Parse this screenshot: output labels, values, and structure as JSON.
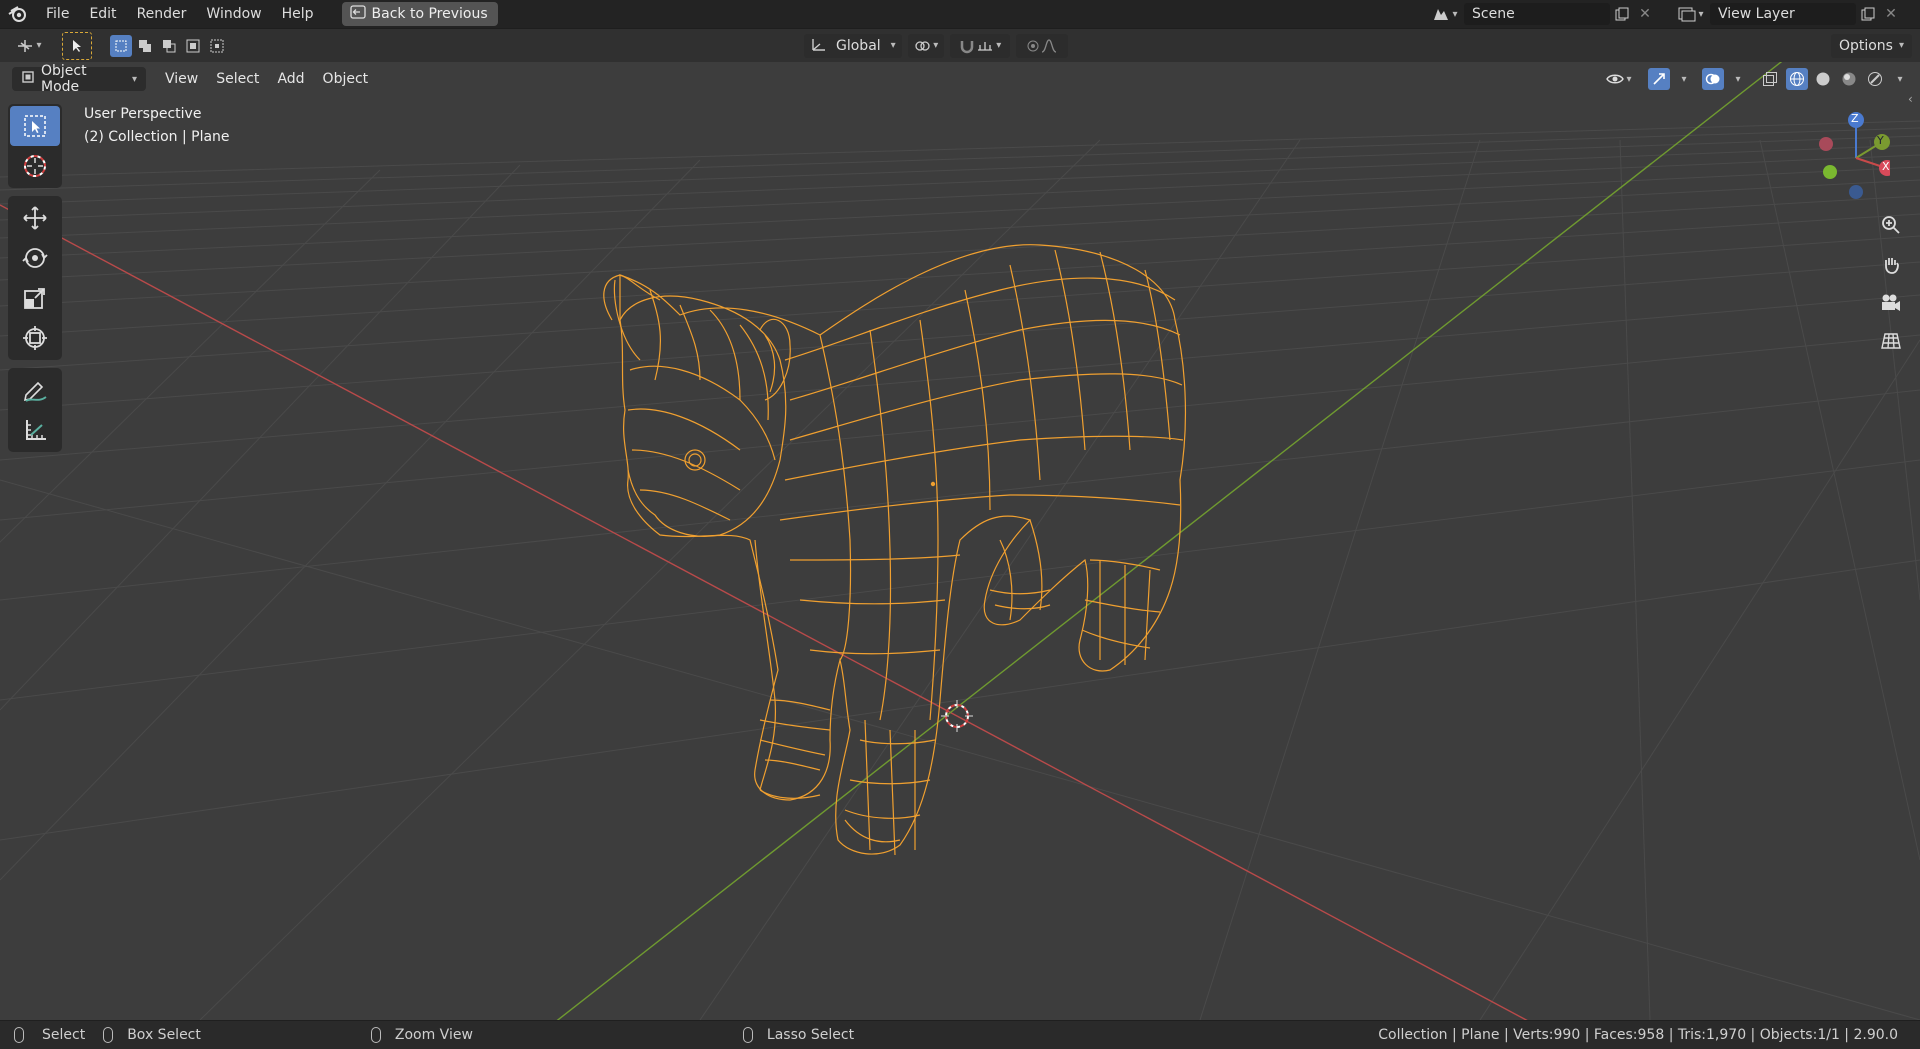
{
  "topbar": {
    "menus": [
      "File",
      "Edit",
      "Render",
      "Window",
      "Help"
    ],
    "back_button": "Back to Previous",
    "scene_name": "Scene",
    "view_layer_name": "View Layer"
  },
  "tool_header": {
    "transform_orientation": "Global",
    "options_label": "Options"
  },
  "viewport_header": {
    "mode": "Object Mode",
    "menus": [
      "View",
      "Select",
      "Add",
      "Object"
    ]
  },
  "viewport": {
    "perspective_label": "User Perspective",
    "collection_label": "(2) Collection | Plane",
    "gizmo_axes": {
      "x": "X",
      "y": "Y",
      "z": "Z"
    },
    "wire_color": "#f0a030",
    "x_axis_color": "#b84a4a",
    "y_axis_color": "#6f9a30"
  },
  "toolbar": {
    "tools": [
      "select-box",
      "cursor",
      "move",
      "rotate",
      "scale",
      "transform",
      "annotate",
      "measure"
    ],
    "active_tool": "select-box"
  },
  "statusbar": {
    "select": "Select",
    "box_select": "Box Select",
    "zoom_view": "Zoom View",
    "lasso_select": "Lasso Select",
    "stats": "Collection | Plane | Verts:990 | Faces:958 | Tris:1,970 | Objects:1/1 | 2.90.0"
  }
}
